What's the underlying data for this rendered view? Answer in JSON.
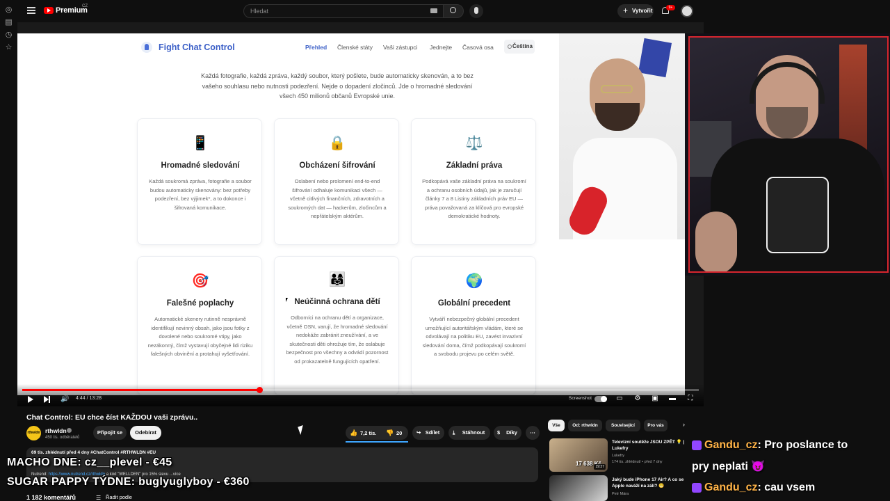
{
  "youtube": {
    "logo_text": "Premium",
    "region": "CZ",
    "search_placeholder": "Hledat",
    "create_label": "Vytvořit",
    "notifications_badge": "9+"
  },
  "site": {
    "title": "Fight Chat Control",
    "nav": [
      "Přehled",
      "Členské státy",
      "Vaši zástupci",
      "Jednejte",
      "Časová osa"
    ],
    "language": "Čeština",
    "intro": "Každá fotografie, každá zpráva, každý soubor, který pošlete, bude automaticky skenován, a to bez vašeho souhlasu nebo nutnosti podezření. Nejde o dopadení zločinců. Jde o hromadné sledování všech 450 milionů občanů Evropské unie.",
    "cards": [
      {
        "icon": "📱",
        "title": "Hromadné sledování",
        "text": "Každá soukromá zpráva, fotografie a soubor budou automaticky skenovány: bez potřeby podezření, bez výjimek*, a to dokonce i šifrovaná komunikace."
      },
      {
        "icon": "🔒",
        "title": "Obcházení šifrování",
        "text": "Oslabení nebo prolomení end-to-end šifrování odhaluje komunikaci všech — včetně citlivých finančních, zdravotních a soukromých dat — hackerům, zločincům a nepřátelským aktérům."
      },
      {
        "icon": "⚖️",
        "title": "Základní práva",
        "text": "Podkopává vaše základní práva na soukromí a ochranu osobních údajů, jak je zaručují články 7 a 8 Listiny základních práv EU — práva považovaná za klíčová pro evropské demokratické hodnoty."
      },
      {
        "icon": "🎯",
        "title": "Falešné poplachy",
        "text": "Automatické skenery rutinně nesprávně identifikují nevinný obsah, jako jsou fotky z dovolené nebo soukromé vtipy, jako nezákonný, čímž vystavují obyčejné lidi riziku falešných obvinění a protahují vyšetřování."
      },
      {
        "icon": "👨‍👩‍👧",
        "title": "Neúčinná ochrana dětí",
        "text": "Odborníci na ochranu dětí a organizace, včetně OSN, varují, že hromadné sledování nedokáže zabránit zneužívání, a ve skutečnosti děti ohrožuje tím, že oslabuje bezpečnost pro všechny a odvádí pozornost od prokazatelně fungujících opatření."
      },
      {
        "icon": "🌍",
        "title": "Globální precedent",
        "text": "Vytváří nebezpečný globální precedent umožňující autoritářským vládám, které se odvolávají na politiku EU, zavést invazivní sledování doma, čímž podkopávají soukromí a svobodu projevu po celém světě."
      }
    ]
  },
  "player": {
    "time": "4:44 / 13:28",
    "progress": 0.352,
    "screenshot_label": "Screenshot"
  },
  "video": {
    "title": "Chat Control: EU chce číst KAŽDOU vaši zprávu..",
    "channel": "rthwldn",
    "subscribers": "450 tis. odběratelů",
    "join_label": "Připojit se",
    "subscribe_label": "Odebírat",
    "likes": "7,2 tis.",
    "dislikes": "20",
    "share_label": "Sdílet",
    "download_label": "Stáhnout",
    "thanks_label": "Díky",
    "description_stats": "69 tis. zhlédnutí  před 4 dny  #ChatControl #RTHWLDN #EU",
    "description_promo_prefix": "Nutrend: ",
    "description_promo_link": "https://www.nutrend.cz/rthwldn",
    "description_promo_suffix": " a kód \"WELLDEN\" pro 15% slevu ...více",
    "comments_count": "1 182 komentářů",
    "sort_label": "Řadit podle"
  },
  "related": {
    "chips": [
      "Vše",
      "Od: rthwldn",
      "Související",
      "Pro vás"
    ],
    "items": [
      {
        "title": "Televizní soutěže JSOU ZPĚT 💡 | Lukefry",
        "channel": "Lukefry",
        "meta": "174 tis. zhlédnutí • před 7 dny",
        "duration": "19:27",
        "thumb_text": "17 638 Kč"
      },
      {
        "title": "Jaký bude iPhone 17 Air? A co se Apple naváží na zálí? 😬",
        "channel": "Petr Mára",
        "meta": "",
        "duration": "",
        "thumb_text": ""
      }
    ]
  },
  "overlay": {
    "donations": [
      "MACHO DNE: cz__plevel - €45",
      "SUGAR PAPPY TÝDNE: buglyuglyboy - €360"
    ],
    "chat": [
      {
        "user": "Gandu_cz",
        "message": ": Pro poslance to",
        "continuation": "pry neplati 😈"
      },
      {
        "user": "Gandu_cz",
        "message": ": cau vsem",
        "continuation": ""
      }
    ]
  },
  "colors": {
    "yt_red": "#ff0000",
    "site_accent": "#3b5fc7",
    "webcam_border": "#d7262e",
    "chat_user": "#ffb347",
    "twitch_badge": "#9146ff"
  }
}
